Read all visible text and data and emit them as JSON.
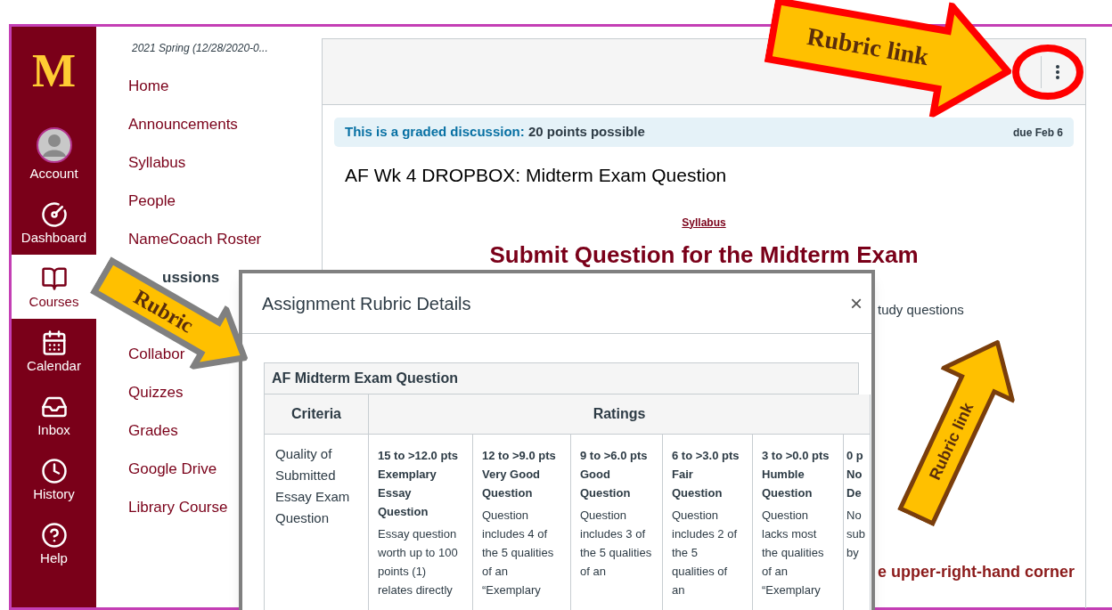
{
  "global_nav": {
    "logo": "M",
    "items": [
      {
        "label": "Account",
        "kind": "avatar",
        "selected": false
      },
      {
        "label": "Dashboard",
        "kind": "gauge",
        "selected": false
      },
      {
        "label": "Courses",
        "kind": "book",
        "selected": true
      },
      {
        "label": "Calendar",
        "kind": "calendar",
        "selected": false
      },
      {
        "label": "Inbox",
        "kind": "inbox",
        "selected": false
      },
      {
        "label": "History",
        "kind": "clock",
        "selected": false
      },
      {
        "label": "Help",
        "kind": "help",
        "selected": false
      }
    ]
  },
  "course_nav": {
    "term": "2021 Spring (12/28/2020-0...",
    "groups": [
      [
        {
          "label": "Home",
          "selected": false
        },
        {
          "label": "Announcements",
          "selected": false
        },
        {
          "label": "Syllabus",
          "selected": false
        },
        {
          "label": "People",
          "selected": false
        },
        {
          "label": "NameCoach Roster",
          "selected": false
        },
        {
          "label": "ussions",
          "selected": true
        }
      ],
      [
        {
          "label": "Collabor",
          "selected": false
        },
        {
          "label": "Quizzes",
          "selected": false
        },
        {
          "label": "Grades",
          "selected": false
        },
        {
          "label": "Google Drive",
          "selected": false
        },
        {
          "label": "Library Course",
          "selected": false
        }
      ]
    ]
  },
  "content": {
    "banner": {
      "lead": "This is a graded discussion:",
      "points": "20 points possible",
      "due": "due Feb 6"
    },
    "title": "AF Wk 4 DROPBOX: Midterm Exam Question",
    "link": "Syllabus",
    "heading": "Submit Question for the Midterm Exam",
    "fragments": [
      {
        "text": "tudy questions",
        "kind": "plain"
      },
      {
        "text": "e upper-right-hand corner",
        "kind": "emphasis"
      }
    ]
  },
  "modal": {
    "title": "Assignment Rubric Details",
    "close": "×",
    "rubric": {
      "title": "AF Midterm Exam Question",
      "columns": [
        "Criteria",
        "Ratings"
      ],
      "criterion": "Quality of Submitted Essay Exam Question",
      "ratings": [
        {
          "points": "15 to >12.0 pts",
          "name": "Exemplary Essay Question",
          "description": "Essay question worth up to 100 points (1) relates directly"
        },
        {
          "points": "12 to >9.0 pts",
          "name": "Very Good Question",
          "description": "Question includes 4 of the 5 qualities of an “Exemplary"
        },
        {
          "points": "9 to >6.0 pts",
          "name": "Good Question",
          "description": "Question includes 3 of the 5 qualities of an"
        },
        {
          "points": "6 to >3.0 pts",
          "name": "Fair Question",
          "description": "Question includes 2 of the 5 qualities of an"
        },
        {
          "points": "3 to >0.0 pts",
          "name": "Humble Question",
          "description": "Question lacks most the qualities of an “Exemplary"
        },
        {
          "points": "0 p",
          "name": "No De",
          "description": "No sub by"
        }
      ]
    }
  },
  "annotations": [
    {
      "text": "Rubric link",
      "kind": "red"
    },
    {
      "text": "Rubric",
      "kind": "grey"
    },
    {
      "text": "Rubric link",
      "kind": "brown"
    }
  ]
}
